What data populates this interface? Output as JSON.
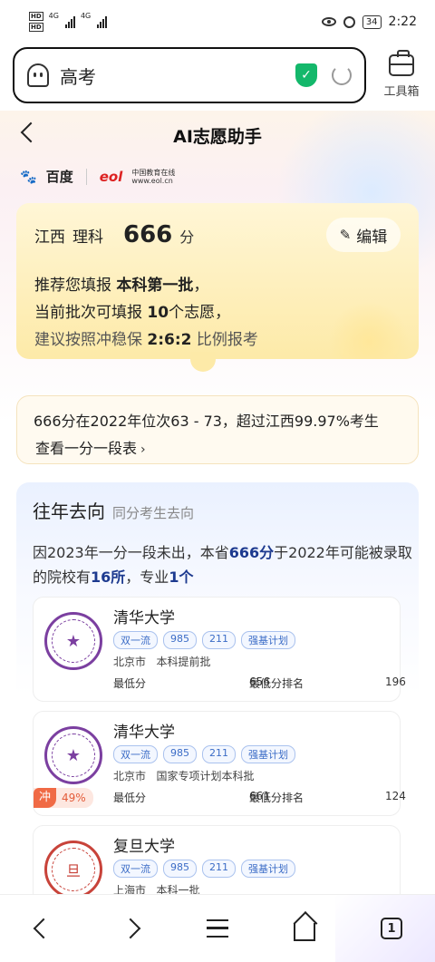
{
  "status_bar": {
    "time": "2:22",
    "battery": "34",
    "net1": "4G",
    "net2": "4G",
    "hd1": "HD",
    "hd2": "HD"
  },
  "browser": {
    "address_text": "高考",
    "toolbox_label": "工具箱",
    "tabs_count": "1"
  },
  "header": {
    "title": "AI志愿助手"
  },
  "logos": {
    "baidu": "百度",
    "eol_cn": "中国教育在线",
    "eol": "eol",
    "eol_url": "www.eol.cn"
  },
  "score_card": {
    "province": "江西",
    "track": "理科",
    "score": "666",
    "score_unit": "分",
    "edit_label": "编辑",
    "line1_prefix": "推荐您填报 ",
    "line1_bold": "本科第一批",
    "line1_suffix": "，",
    "line2_prefix": "当前批次可填报 ",
    "line2_bold": "10",
    "line2_suffix": "个志愿，",
    "line3_prefix": "建议按照冲稳保 ",
    "line3_bold": "2:6:2",
    "line3_suffix": " 比例报考"
  },
  "rank_card": {
    "line1": "666分在2022年位次63 - 73，超过江西99.97%考生",
    "link": "查看一分一段表",
    "chevron": "›"
  },
  "history": {
    "title": "往年去向",
    "subtitle": "同分考生去向",
    "desc_a": "因2023年一分一段未出，本省",
    "desc_b": "666分",
    "desc_c": "于2022年可能被录取的院校有",
    "desc_d": "16所",
    "desc_e": "，专业",
    "desc_f": "1个",
    "universities": [
      {
        "name": "清华大学",
        "tags": [
          "双一流",
          "985",
          "211",
          "强基计划"
        ],
        "location": "北京市",
        "batch": "本科提前批",
        "min_score_label": "最低分",
        "min_score": "656",
        "min_rank_label": "最低分排名",
        "min_rank": "196"
      },
      {
        "name": "清华大学",
        "tags": [
          "双一流",
          "985",
          "211",
          "强基计划"
        ],
        "location": "北京市",
        "batch": "国家专项计划本科批",
        "min_score_label": "最低分",
        "min_score": "661",
        "min_rank_label": "最低分排名",
        "min_rank": "124",
        "badge": "冲",
        "badge_pct": "49%"
      },
      {
        "name": "复旦大学",
        "tags": [
          "双一流",
          "985",
          "211",
          "强基计划"
        ],
        "location": "上海市",
        "batch": "本科一批"
      }
    ]
  },
  "colors": {
    "accent_blue": "#1d3a8f",
    "card_yellow": "#fdeaa8",
    "shield_green": "#14b86b",
    "chong_red": "#f06a45"
  }
}
